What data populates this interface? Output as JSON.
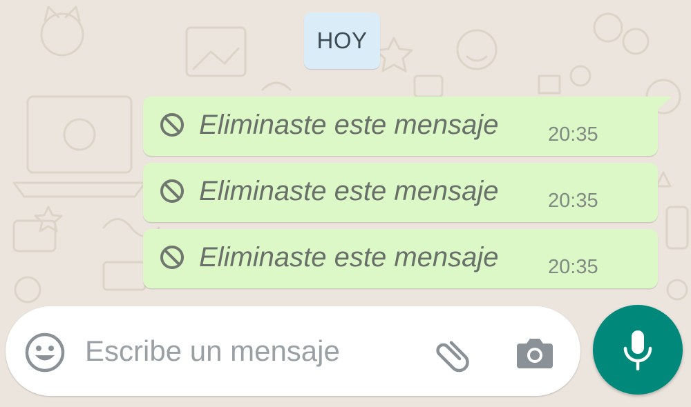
{
  "chat": {
    "date_divider": "HOY",
    "messages": [
      {
        "text": "Eliminaste este mensaje",
        "time": "20:35",
        "icon": "prohibited-icon"
      },
      {
        "text": "Eliminaste este mensaje",
        "time": "20:35",
        "icon": "prohibited-icon"
      },
      {
        "text": "Eliminaste este mensaje",
        "time": "20:35",
        "icon": "prohibited-icon"
      }
    ]
  },
  "composer": {
    "placeholder": "Escribe un mensaje",
    "value": "",
    "icons": [
      "emoji-icon",
      "paperclip-icon",
      "camera-icon",
      "microphone-icon"
    ]
  },
  "colors": {
    "background": "#ece5dd",
    "outgoing_bubble": "#dcf8c6",
    "date_chip": "#d9ecf7",
    "accent": "#00897b"
  }
}
